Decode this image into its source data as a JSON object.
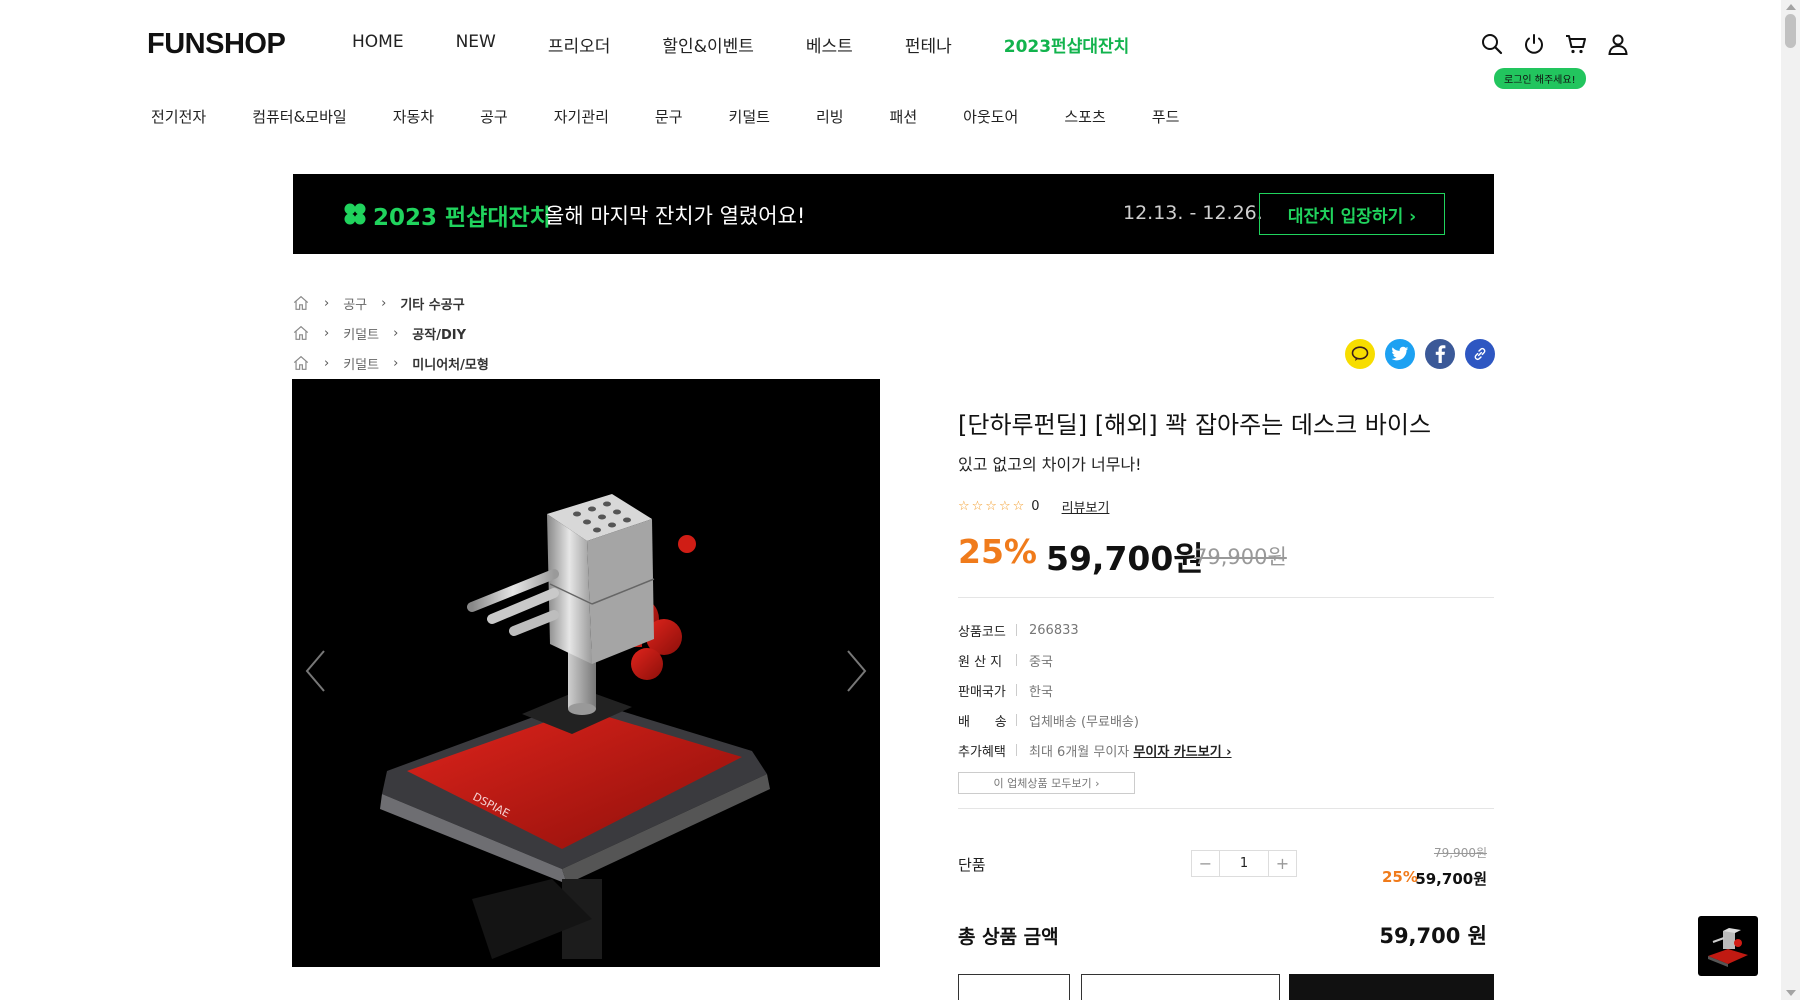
{
  "header": {
    "logo": "FUNSHOP",
    "nav": [
      "HOME",
      "NEW",
      "프리오더",
      "할인&이벤트",
      "베스트",
      "펀테나",
      "2023펀샵대잔치"
    ],
    "icons": [
      "search-icon",
      "power-icon",
      "cart-icon",
      "user-icon"
    ],
    "login_tip": "로그인 해주세요!"
  },
  "categories": [
    "전기전자",
    "컴퓨터&모바일",
    "자동차",
    "공구",
    "자기관리",
    "문구",
    "키덜트",
    "리빙",
    "패션",
    "아웃도어",
    "스포츠",
    "푸드"
  ],
  "banner": {
    "title": "2023 펀샵대잔치",
    "subtitle": "올해 마지막 잔치가 열렸어요!",
    "date": "12.13. - 12.26.",
    "button": "대잔치 입장하기 ›",
    "accent": "#20d35d"
  },
  "breadcrumbs": [
    {
      "c1": "공구",
      "c2": "기타 수공구"
    },
    {
      "c1": "키덜트",
      "c2": "공작/DIY"
    },
    {
      "c1": "키덜트",
      "c2": "미니어처/모형"
    }
  ],
  "share": {
    "icons": [
      "kakaotalk-icon",
      "twitter-icon",
      "facebook-icon",
      "link-icon"
    ],
    "colors": [
      "#f7dd00",
      "#1da1f2",
      "#3b5998",
      "#2e57c2"
    ]
  },
  "product": {
    "title": "[단하루펀딜] [해외] 꽉 잡아주는 데스크 바이스",
    "subtitle": "있고 없고의 차이가 너무나!",
    "stars": "☆☆☆☆☆",
    "review_count": "0",
    "review_link": "리뷰보기",
    "discount": "25%",
    "price": "59,700원",
    "original_price": "79,900원",
    "accent": "#f07b1b",
    "info": [
      {
        "k": "상품코드",
        "v": "266833"
      },
      {
        "k": "원 산 지",
        "v": "중국"
      },
      {
        "k": "판매국가",
        "v": "한국"
      },
      {
        "k": "배      송",
        "v": "업체배송 (무료배송)"
      },
      {
        "k": "추가혜택",
        "v": "최대 6개월 무이자",
        "link": "무이자 카드보기 ›"
      }
    ],
    "all_products_btn": "이 업체상품 모두보기  ›"
  },
  "option": {
    "name": "단품",
    "qty": "1",
    "minus": "−",
    "plus": "+",
    "original": "79,900원",
    "discount": "25%",
    "price": "59,700원"
  },
  "total": {
    "label": "총 상품 금액",
    "value": "59,700 원"
  }
}
